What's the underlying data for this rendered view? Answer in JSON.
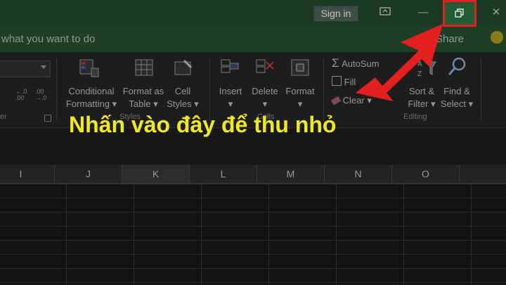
{
  "titlebar": {
    "sign_in": "Sign in",
    "icons": [
      "ribbon-display-options-icon",
      "minimize-icon",
      "restore-down-icon",
      "close-icon"
    ],
    "minimize_glyph": "—",
    "close_glyph": "✕"
  },
  "tellbar": {
    "tell_me": "what you want to do",
    "share": "Share"
  },
  "ribbon": {
    "styles": {
      "label": "Styles",
      "conditional_1": "Conditional",
      "conditional_2": "Formatting",
      "format_table_1": "Format as",
      "format_table_2": "Table",
      "cell_styles_1": "Cell",
      "cell_styles_2": "Styles"
    },
    "cells": {
      "label": "Cells",
      "insert": "Insert",
      "delete": "Delete",
      "format": "Format"
    },
    "editing": {
      "label": "Editing",
      "autosum": "AutoSum",
      "fill": "Fill",
      "clear": "Clear",
      "sort_1": "Sort &",
      "sort_2": "Filter",
      "find_1": "Find &",
      "find_2": "Select"
    },
    "number": {
      "dec_increase": "←.0 .00",
      "dec_decrease": ".00 →.0",
      "label": "er"
    }
  },
  "caption": "Nhấn vào đây để thu nhỏ",
  "columns": [
    "I",
    "J",
    "K",
    "L",
    "M",
    "N",
    "O"
  ],
  "selected_column": "K",
  "colors": {
    "title_green": "#1b3a26",
    "highlight_red": "#e31f1f",
    "caption_yellow": "#f1ea1a"
  }
}
